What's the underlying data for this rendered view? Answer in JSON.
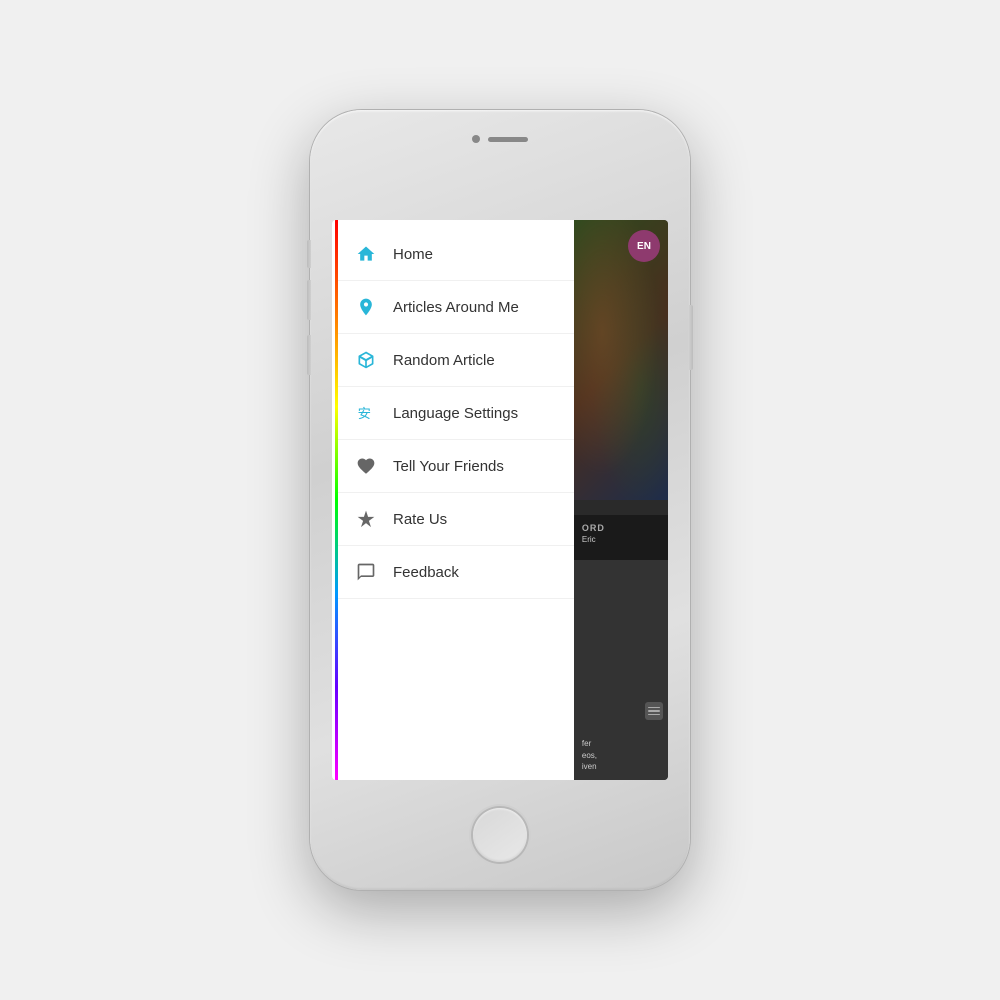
{
  "phone": {
    "front_camera_alt": "front camera",
    "speaker_alt": "speaker"
  },
  "lang_badge": {
    "text": "EN"
  },
  "menu": {
    "items": [
      {
        "id": "home",
        "label": "Home",
        "icon": "home-icon",
        "icon_color": "blue"
      },
      {
        "id": "articles-around-me",
        "label": "Articles Around Me",
        "icon": "location-icon",
        "icon_color": "blue"
      },
      {
        "id": "random-article",
        "label": "Random Article",
        "icon": "cube-icon",
        "icon_color": "blue"
      },
      {
        "id": "language-settings",
        "label": "Language Settings",
        "icon": "language-icon",
        "icon_color": "blue"
      },
      {
        "id": "tell-your-friends",
        "label": "Tell Your Friends",
        "icon": "heart-icon",
        "icon_color": "gray"
      },
      {
        "id": "rate-us",
        "label": "Rate Us",
        "icon": "star-icon",
        "icon_color": "gray"
      },
      {
        "id": "feedback",
        "label": "Feedback",
        "icon": "chat-icon",
        "icon_color": "gray"
      }
    ]
  },
  "bg_content": {
    "card_mid_label": "ORD",
    "card_mid_subtitle": "Eric",
    "card_bottom_text1": "fer",
    "card_bottom_text2": "eos,",
    "card_bottom_text3": "iven"
  }
}
